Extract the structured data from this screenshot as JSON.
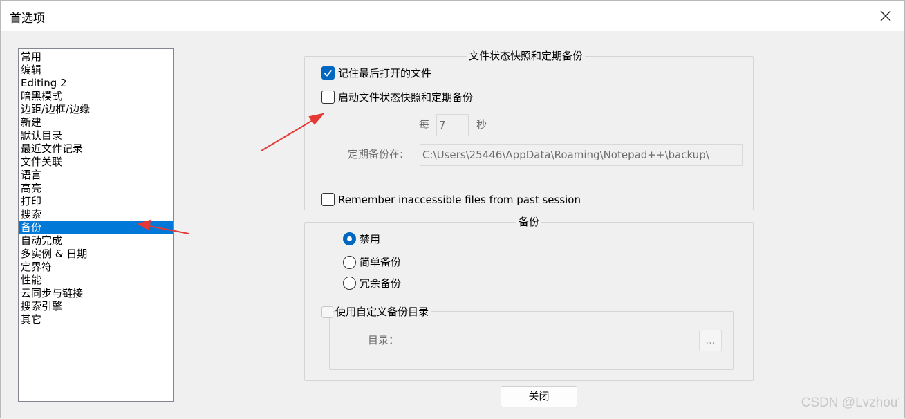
{
  "window": {
    "title": "首选项"
  },
  "sidebar": {
    "items": [
      {
        "label": "常用"
      },
      {
        "label": "编辑"
      },
      {
        "label": "Editing 2"
      },
      {
        "label": "暗黑模式"
      },
      {
        "label": "边距/边框/边缘"
      },
      {
        "label": "新建"
      },
      {
        "label": "默认目录"
      },
      {
        "label": "最近文件记录"
      },
      {
        "label": "文件关联"
      },
      {
        "label": "语言"
      },
      {
        "label": "高亮"
      },
      {
        "label": "打印"
      },
      {
        "label": "搜索"
      },
      {
        "label": "备份",
        "selected": true
      },
      {
        "label": "自动完成"
      },
      {
        "label": "多实例 & 日期"
      },
      {
        "label": "定界符"
      },
      {
        "label": "性能"
      },
      {
        "label": "云同步与链接"
      },
      {
        "label": "搜索引擎"
      },
      {
        "label": "其它"
      }
    ]
  },
  "snapshot_group": {
    "title": "文件状态快照和定期备份",
    "remember_last_session": {
      "label": "记住最后打开的文件",
      "checked": true
    },
    "enable_snapshot": {
      "label": "启动文件状态快照和定期备份",
      "checked": false
    },
    "every_label": "每",
    "interval_value": "7",
    "seconds_label": "秒",
    "backup_path_label": "定期备份在:",
    "backup_path_value": "C:\\Users\\25446\\AppData\\Roaming\\Notepad++\\backup\\",
    "remember_inaccessible": {
      "label": "Remember inaccessible files from past session",
      "checked": false
    }
  },
  "backup_group": {
    "title": "备份",
    "options": [
      {
        "label": "禁用",
        "selected": true
      },
      {
        "label": "简单备份",
        "selected": false
      },
      {
        "label": "冗余备份",
        "selected": false
      }
    ],
    "custom_dir": {
      "label": "使用自定义备份目录",
      "checked": false
    },
    "dir_label": "目录：",
    "dir_value": "",
    "browse_label": "..."
  },
  "footer": {
    "close_label": "关闭"
  },
  "watermark": "CSDN @Lvzhou'",
  "colors": {
    "accent": "#0078d7",
    "annotation_arrow": "#e53935"
  }
}
